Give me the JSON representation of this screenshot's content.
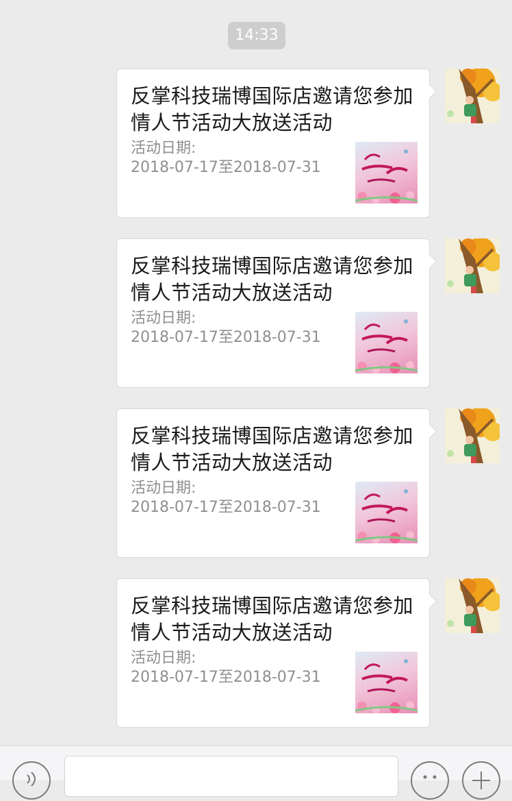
{
  "chat": {
    "timestamp": "14:33",
    "messages": [
      {
        "title": "反掌科技瑞博国际店邀请您参加情人节活动大放送活动",
        "date_label": "活动日期:",
        "date_range": "2018-07-17至2018-07-31",
        "thumbnail_icon": "valentines-poster-image",
        "avatar_icon": "tree-avatar-image"
      },
      {
        "title": "反掌科技瑞博国际店邀请您参加情人节活动大放送活动",
        "date_label": "活动日期:",
        "date_range": "2018-07-17至2018-07-31",
        "thumbnail_icon": "valentines-poster-image",
        "avatar_icon": "tree-avatar-image"
      },
      {
        "title": "反掌科技瑞博国际店邀请您参加情人节活动大放送活动",
        "date_label": "活动日期:",
        "date_range": "2018-07-17至2018-07-31",
        "thumbnail_icon": "valentines-poster-image",
        "avatar_icon": "tree-avatar-image"
      },
      {
        "title": "反掌科技瑞博国际店邀请您参加情人节活动大放送活动",
        "date_label": "活动日期:",
        "date_range": "2018-07-17至2018-07-31",
        "thumbnail_icon": "valentines-poster-image",
        "avatar_icon": "tree-avatar-image"
      }
    ]
  },
  "input_bar": {
    "icons": [
      "voice-icon",
      "emoji-icon",
      "plus-icon"
    ]
  },
  "colors": {
    "background": "#ebebeb",
    "bubble": "#ffffff",
    "timestamp_bg": "#cecece",
    "secondary_text": "#8f8f8f"
  }
}
